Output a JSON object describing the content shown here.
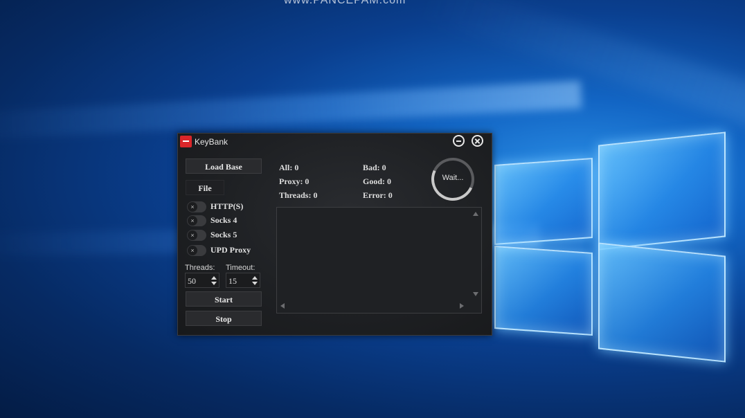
{
  "desktop": {
    "watermark": "www.PANCEPAM.com"
  },
  "window": {
    "title": "KeyBank",
    "app_icon": "keybank-logo-icon",
    "minimize_icon": "minus-circle-icon",
    "close_icon": "close-circle-icon"
  },
  "left_panel": {
    "load_base_label": "Load Base",
    "file_label": "File",
    "proxy_types": [
      {
        "label": "HTTP(S)",
        "enabled": false
      },
      {
        "label": "Socks 4",
        "enabled": false
      },
      {
        "label": "Socks 5",
        "enabled": false
      },
      {
        "label": "UPD Proxy",
        "enabled": false
      }
    ],
    "toggle_off_glyph": "×",
    "threads_label": "Threads:",
    "threads_value": "50",
    "timeout_label": "Timeout:",
    "timeout_value": "15",
    "start_label": "Start",
    "stop_label": "Stop"
  },
  "stats": {
    "all": "All: 0",
    "proxy": "Proxy: 0",
    "threads": "Threads: 0",
    "bad": "Bad: 0",
    "good": "Good: 0",
    "error": "Error: 0"
  },
  "status": {
    "spinner_text": "Wait..."
  },
  "log": {
    "content": ""
  }
}
